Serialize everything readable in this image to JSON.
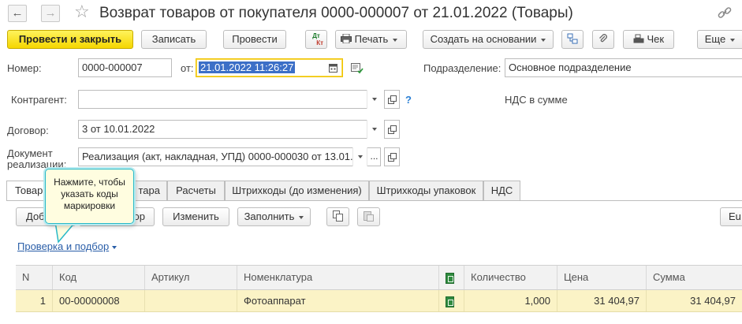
{
  "window": {
    "title": "Возврат товаров от покупателя 0000-000007 от 21.01.2022 (Товары)"
  },
  "toolbar": {
    "post_close_label": "Провести и закрыть",
    "save_label": "Записать",
    "post_label": "Провести",
    "dtkt_top": "Дт",
    "dtkt_bottom": "Кт",
    "print_label": "Печать",
    "create_basis_label": "Создать на основании",
    "receipt_label": "Чек",
    "more_label": "Еще"
  },
  "form": {
    "number_label": "Номер:",
    "number_value": "0000-000007",
    "date_label": "от:",
    "date_value": "21.01.2022 11:26:27",
    "division_label": "Подразделение:",
    "division_value": "Основное подразделение",
    "counterparty_label": "Контрагент:",
    "counterparty_value": "",
    "help_mark": "?",
    "vat_note": "НДС в сумме",
    "contract_label": "Договор:",
    "contract_value": "3 от 10.01.2022",
    "doc_label_line1": "Документ",
    "doc_label_line2": "реализации:",
    "doc_value": "Реализация (акт, накладная, УПД) 0000-000030 от 13.01...",
    "doc_dots": "..."
  },
  "tabs": [
    {
      "label": "Товары"
    },
    {
      "label": "тара"
    },
    {
      "label": "Расчеты"
    },
    {
      "label": "Штрихкоды (до изменения)"
    },
    {
      "label": "Штрихкоды упаковок"
    },
    {
      "label": "НДС"
    }
  ],
  "table_toolbar": {
    "add_label": "Доб",
    "pick_label": "ор",
    "edit_label": "Изменить",
    "fill_label": "Заполнить",
    "right_cut_label": "Eu"
  },
  "check_link": "Проверка и подбор",
  "tooltip": {
    "line1": "Нажмите, чтобы",
    "line2": "указать коды",
    "line3": "маркировки"
  },
  "table": {
    "columns": [
      "N",
      "Код",
      "Артикул",
      "Номенклатура",
      "",
      "Количество",
      "Цена",
      "Сумма"
    ],
    "rows": [
      {
        "n": "1",
        "code": "00-00000008",
        "article": "",
        "item": "Фотоаппарат",
        "qty": "1,000",
        "price": "31 404,97",
        "sum": "31 404,97"
      }
    ]
  },
  "colors": {
    "primary_button": "#f5d600",
    "selection": "#3c6fc7",
    "row_highlight": "#fbf3c6",
    "link": "#2a5ea8",
    "tooltip_border": "#28b9c8"
  }
}
